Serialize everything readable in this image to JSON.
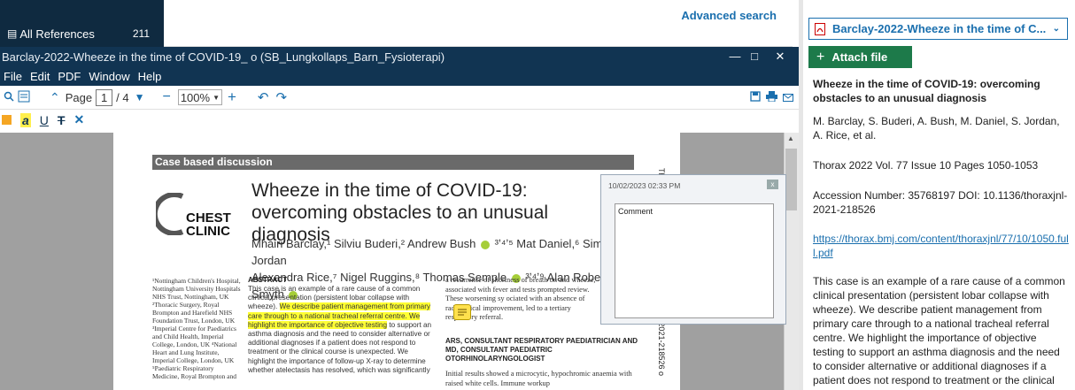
{
  "library": {
    "all_refs_label": "All References",
    "all_refs_count": "211"
  },
  "search": {
    "advanced_label": "Advanced search"
  },
  "window": {
    "title": "Barclay-2022-Wheeze in the time of COVID-19_ o (SB_Lungkollaps_Barn_Fysioterapi)",
    "minimize": "—",
    "maximize": "□",
    "close": "✕"
  },
  "menu": [
    "File",
    "Edit",
    "PDF",
    "Window",
    "Help"
  ],
  "toolbar": {
    "page_label": "Page",
    "page_current": "1",
    "page_total": "/ 4",
    "zoom_value": "100%",
    "zoom_minus": "−",
    "zoom_plus": "+"
  },
  "article": {
    "section": "Case based discussion",
    "title": "Wheeze in the time of COVID-19: overcoming obstacles to an unusual diagnosis",
    "logo_line1": "CHEST",
    "logo_line2": "CLINIC",
    "authors_l1": "Mhairi Barclay,¹ Silviu Buderi,² Andrew Bush",
    "authors_l1b": "³ʼ⁴ʼ⁵ Mat Daniel,⁶ Simon Jordan",
    "authors_l2": "Alexandra Rice,⁷ Nigel Ruggins,⁸ Thomas Semple",
    "authors_l2b": "³ʼ⁴ʼ⁹ Alan Robert Smyth",
    "affiliations": "¹Nottingham Children's Hospital, Nottingham University Hospitals NHS Trust, Nottingham, UK ²Thoracic Surgery, Royal Brompton and Harefield NHS Foundation Trust, London, UK ³Imperial Centre for Paediatrics and Child Health, Imperial College, London, UK ⁴National Heart and Lung Institute, Imperial College, London, UK ⁵Paediatric Respiratory Medicine, Royal Brompton and",
    "abstract_heading": "ABSTRACT",
    "abstract_p1": "This case is an example of a rare cause of a common clinical presentation (persistent lobar collapse with wheeze).",
    "abstract_hl": "We describe patient management from primary care through to a national tracheal referral centre. We highlight the importance of objective testing",
    "abstract_p2": "to support an asthma diagnosis and the need to consider alternative or additional diagnoses if a patient does not respond to treatment or the clinical course is unexpected. We highlight the importance of follow-up X-ray to determine whether atelectasis has resolved, which was significantly",
    "col3_text": "a recurrence of shortness of breath on and wheeze, associated with fever and tests prompted review. These worsening sy ociated with an absence of radiological improvement, led to a tertiary respiratory referral.",
    "col3_heading": "ARS, CONSULTANT RESPIRATORY PAEDIATRICIAN AND MD, CONSULTANT PAEDIATRIC OTORHINOLARYNGOLOGIST",
    "col3_text2": "Initial results showed a microcytic, hypochromic anaemia with raised white cells. Immune workup",
    "side_strip": "Thorax: first published as 10.1136/thoraxjnl-2021-218526 o"
  },
  "comment_popup": {
    "timestamp": "10/02/2023 02:33 PM",
    "close": "x",
    "content": "Comment"
  },
  "reference": {
    "selector_label": "Barclay-2022-Wheeze in the time of C...",
    "attach_label": "Attach file",
    "title": "Wheeze in the time of COVID-19: overcoming obstacles to an unusual diagnosis",
    "authors": "M. Barclay, S. Buderi, A. Bush, M. Daniel, S. Jordan, A. Rice, et al.",
    "journal": "Thorax 2022 Vol. 77 Issue 10 Pages 1050-1053",
    "accession": "Accession Number: 35768197 DOI: 10.1136/thoraxjnl-2021-218526",
    "url": "https://thorax.bmj.com/content/thoraxjnl/77/10/1050.full.pdf",
    "abstract": "This case is an example of a rare cause of a common clinical presentation (persistent lobar collapse with wheeze). We describe patient management from primary care through to a national tracheal referral centre. We highlight the importance of objective testing to support an asthma diagnosis and the need to consider alternative or additional diagnoses if a patient does not respond to treatment or the clinical"
  },
  "colors": {
    "accent": "#1a6fae",
    "window_bar": "#113452",
    "attach": "#1d7a4a",
    "highlight": "#ffff33"
  }
}
